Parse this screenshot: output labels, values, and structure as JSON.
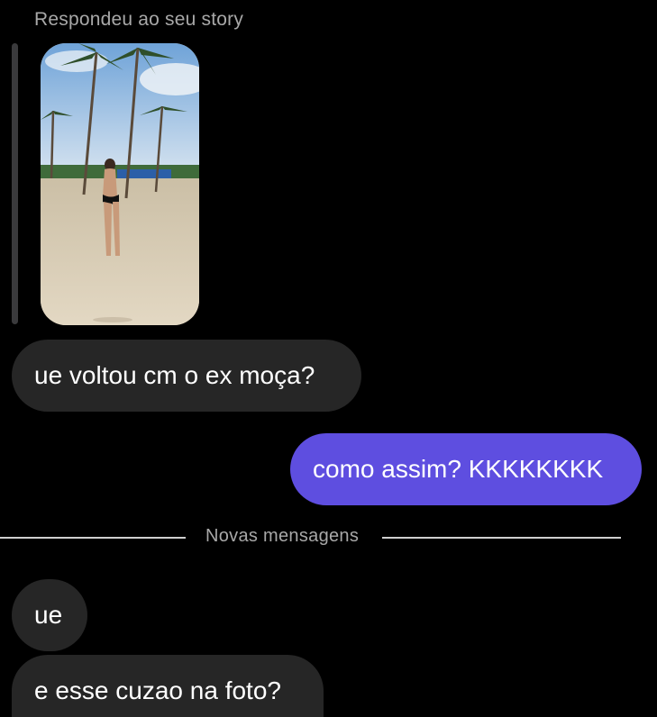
{
  "story_reply": {
    "caption": "Respondeu ao seu story"
  },
  "messages": [
    {
      "direction": "incoming",
      "text": "ue voltou cm o ex moça?"
    },
    {
      "direction": "outgoing",
      "text": "como assim? KKKKKKKK"
    },
    {
      "direction": "incoming",
      "text": "ue"
    },
    {
      "direction": "incoming",
      "text": "e esse cuzao na foto?"
    }
  ],
  "divider": {
    "label": "Novas mensagens"
  },
  "colors": {
    "background": "#000000",
    "incoming_bubble": "#262626",
    "outgoing_bubble": "#5e4ee0",
    "secondary_text": "#a8a8a8"
  }
}
